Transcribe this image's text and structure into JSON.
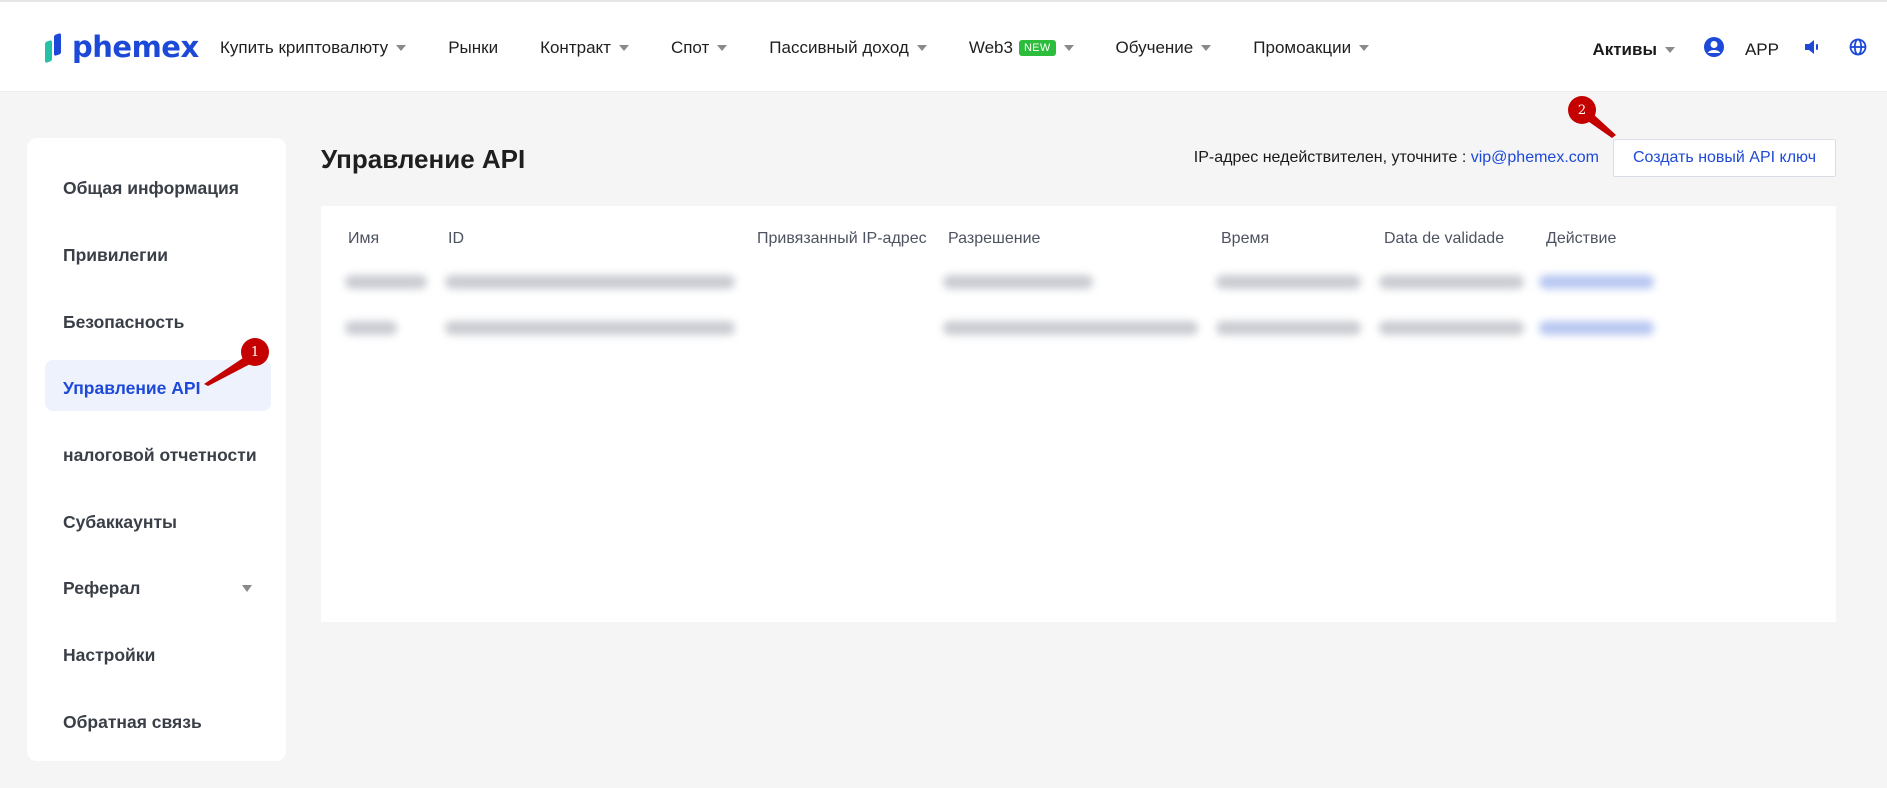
{
  "brand": {
    "name": "phemex"
  },
  "nav": [
    {
      "label": "Купить криптовалюту",
      "caret": true
    },
    {
      "label": "Рынки",
      "caret": false
    },
    {
      "label": "Контракт",
      "caret": true
    },
    {
      "label": "Спот",
      "caret": true
    },
    {
      "label": "Пассивный доход",
      "caret": true
    },
    {
      "label": "Web3",
      "badge": "NEW",
      "caret": true
    },
    {
      "label": "Обучение",
      "caret": true
    },
    {
      "label": "Промоакции",
      "caret": true
    }
  ],
  "header_right": {
    "assets": "Активы",
    "app": "APP"
  },
  "sidebar": {
    "items": [
      {
        "label": "Общая информация"
      },
      {
        "label": "Привилегии"
      },
      {
        "label": "Безопасность"
      },
      {
        "label": "Управление API",
        "active": true
      },
      {
        "label": "налоговой отчетности"
      },
      {
        "label": "Субаккаунты"
      },
      {
        "label": "Реферал",
        "caret": true
      },
      {
        "label": "Настройки"
      },
      {
        "label": "Обратная связь"
      }
    ]
  },
  "main": {
    "title": "Управление API",
    "ip_note": "IP-адрес недействителен, уточните : ",
    "ip_email": "vip@phemex.com",
    "create_button": "Создать новый API ключ",
    "columns": [
      "Имя",
      "ID",
      "Привязанный IP-адрес",
      "Разрешение",
      "Время",
      "Data de validade",
      "Действие"
    ],
    "rows_note": "2 rows, contents blurred"
  },
  "annotations": {
    "marker1": "1",
    "marker2": "2"
  },
  "colors": {
    "accent": "#1d49d8",
    "marker": "#c40000",
    "new_badge": "#2dbd3c"
  }
}
